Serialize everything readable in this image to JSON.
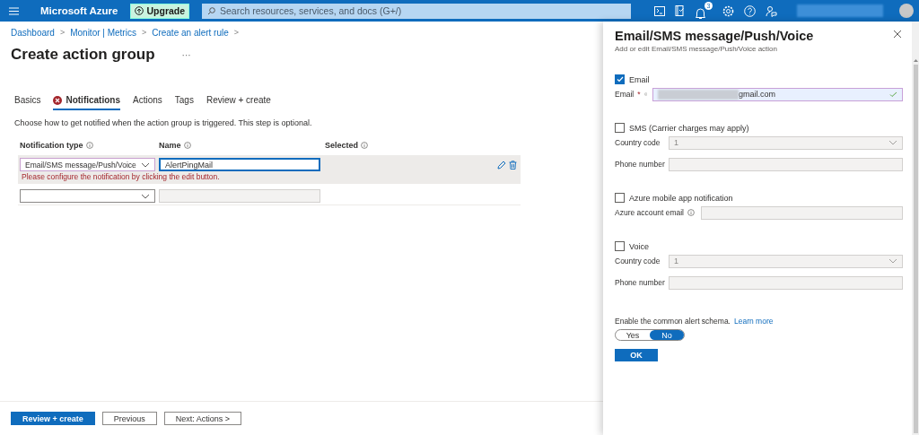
{
  "header": {
    "brand": "Microsoft Azure",
    "upgrade": "Upgrade",
    "search_placeholder": "Search resources, services, and docs (G+/)",
    "notification_count": "3"
  },
  "breadcrumb": [
    {
      "label": "Dashboard",
      "separator": ">"
    },
    {
      "label": "Monitor | Metrics",
      "separator": ">"
    },
    {
      "label": "Create an alert rule",
      "separator": ">"
    }
  ],
  "title": "Create action group",
  "more": "···",
  "tabs": [
    {
      "label": "Basics",
      "selected": false,
      "error": false
    },
    {
      "label": "Notifications",
      "selected": true,
      "error": true
    },
    {
      "label": "Actions",
      "selected": false,
      "error": false
    },
    {
      "label": "Tags",
      "selected": false,
      "error": false
    },
    {
      "label": "Review + create",
      "selected": false,
      "error": false
    }
  ],
  "description": "Choose how to get notified when the action group is triggered. This step is optional.",
  "table": {
    "columns": [
      "Notification type",
      "Name",
      "Selected"
    ],
    "rows": [
      {
        "type": "Email/SMS message/Push/Voice",
        "name": "AlertPingMail",
        "error": "Please configure the notification by clicking the edit button.",
        "selected": true
      },
      {
        "selected": false
      }
    ]
  },
  "footer_buttons": [
    {
      "label": "Review + create",
      "primary": true
    },
    {
      "label": "Previous",
      "primary": false
    },
    {
      "label": "Next: Actions >",
      "primary": false
    }
  ],
  "panel": {
    "title": "Email/SMS message/Push/Voice",
    "subtitle": "Add or edit Email/SMS message/Push/Voice action",
    "sections": [
      {
        "label": "Email",
        "checked": true,
        "fields": [
          {
            "label": "Email",
            "kind": "text",
            "required_mark": "*",
            "info": true,
            "value": "gmail.com",
            "redacted": true,
            "valid": true,
            "disabled": false
          }
        ]
      },
      {
        "label": "SMS (Carrier charges may apply)",
        "checked": false,
        "fields": [
          {
            "label": "Country code",
            "kind": "select",
            "value": "1",
            "disabled": true
          },
          {
            "label": "Phone number",
            "kind": "text",
            "disabled": true
          }
        ]
      },
      {
        "label": "Azure mobile app notification",
        "checked": false,
        "fields": [
          {
            "label": "Azure account email",
            "kind": "text",
            "info": true,
            "disabled": true
          }
        ]
      },
      {
        "label": "Voice",
        "checked": false,
        "fields": [
          {
            "label": "Country code",
            "kind": "select",
            "value": "1",
            "disabled": true
          },
          {
            "label": "Phone number",
            "kind": "text",
            "disabled": true
          }
        ]
      }
    ],
    "schema": {
      "label": "Enable the common alert schema.",
      "link": "Learn more",
      "options": [
        {
          "label": "Yes",
          "selected": false
        },
        {
          "label": "No",
          "selected": true
        }
      ]
    },
    "ok": "OK"
  }
}
